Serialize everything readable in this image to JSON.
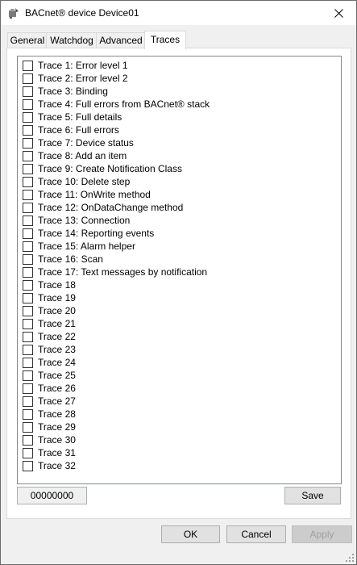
{
  "window": {
    "title": "BACnet® device Device01"
  },
  "tabs": [
    {
      "label": "General"
    },
    {
      "label": "Watchdog"
    },
    {
      "label": "Advanced"
    },
    {
      "label": "Traces",
      "active": true
    }
  ],
  "traces": [
    "Trace 1: Error level 1",
    "Trace 2: Error level 2",
    "Trace 3: Binding",
    "Trace 4: Full errors from BACnet® stack",
    "Trace 5: Full details",
    "Trace 6: Full errors",
    "Trace 7: Device status",
    "Trace 8: Add an item",
    "Trace 9: Create Notification Class",
    "Trace 10: Delete step",
    "Trace 11: OnWrite method",
    "Trace 12: OnDataChange method",
    "Trace 13: Connection",
    "Trace 14: Reporting events",
    "Trace 15: Alarm helper",
    "Trace 16: Scan",
    "Trace 17: Text messages by notification",
    "Trace 18",
    "Trace 19",
    "Trace 20",
    "Trace 21",
    "Trace 22",
    "Trace 23",
    "Trace 24",
    "Trace 25",
    "Trace 26",
    "Trace 27",
    "Trace 28",
    "Trace 29",
    "Trace 30",
    "Trace 31",
    "Trace 32"
  ],
  "mask_value": "00000000",
  "buttons": {
    "save": "Save",
    "ok": "OK",
    "cancel": "Cancel",
    "apply": "Apply"
  }
}
